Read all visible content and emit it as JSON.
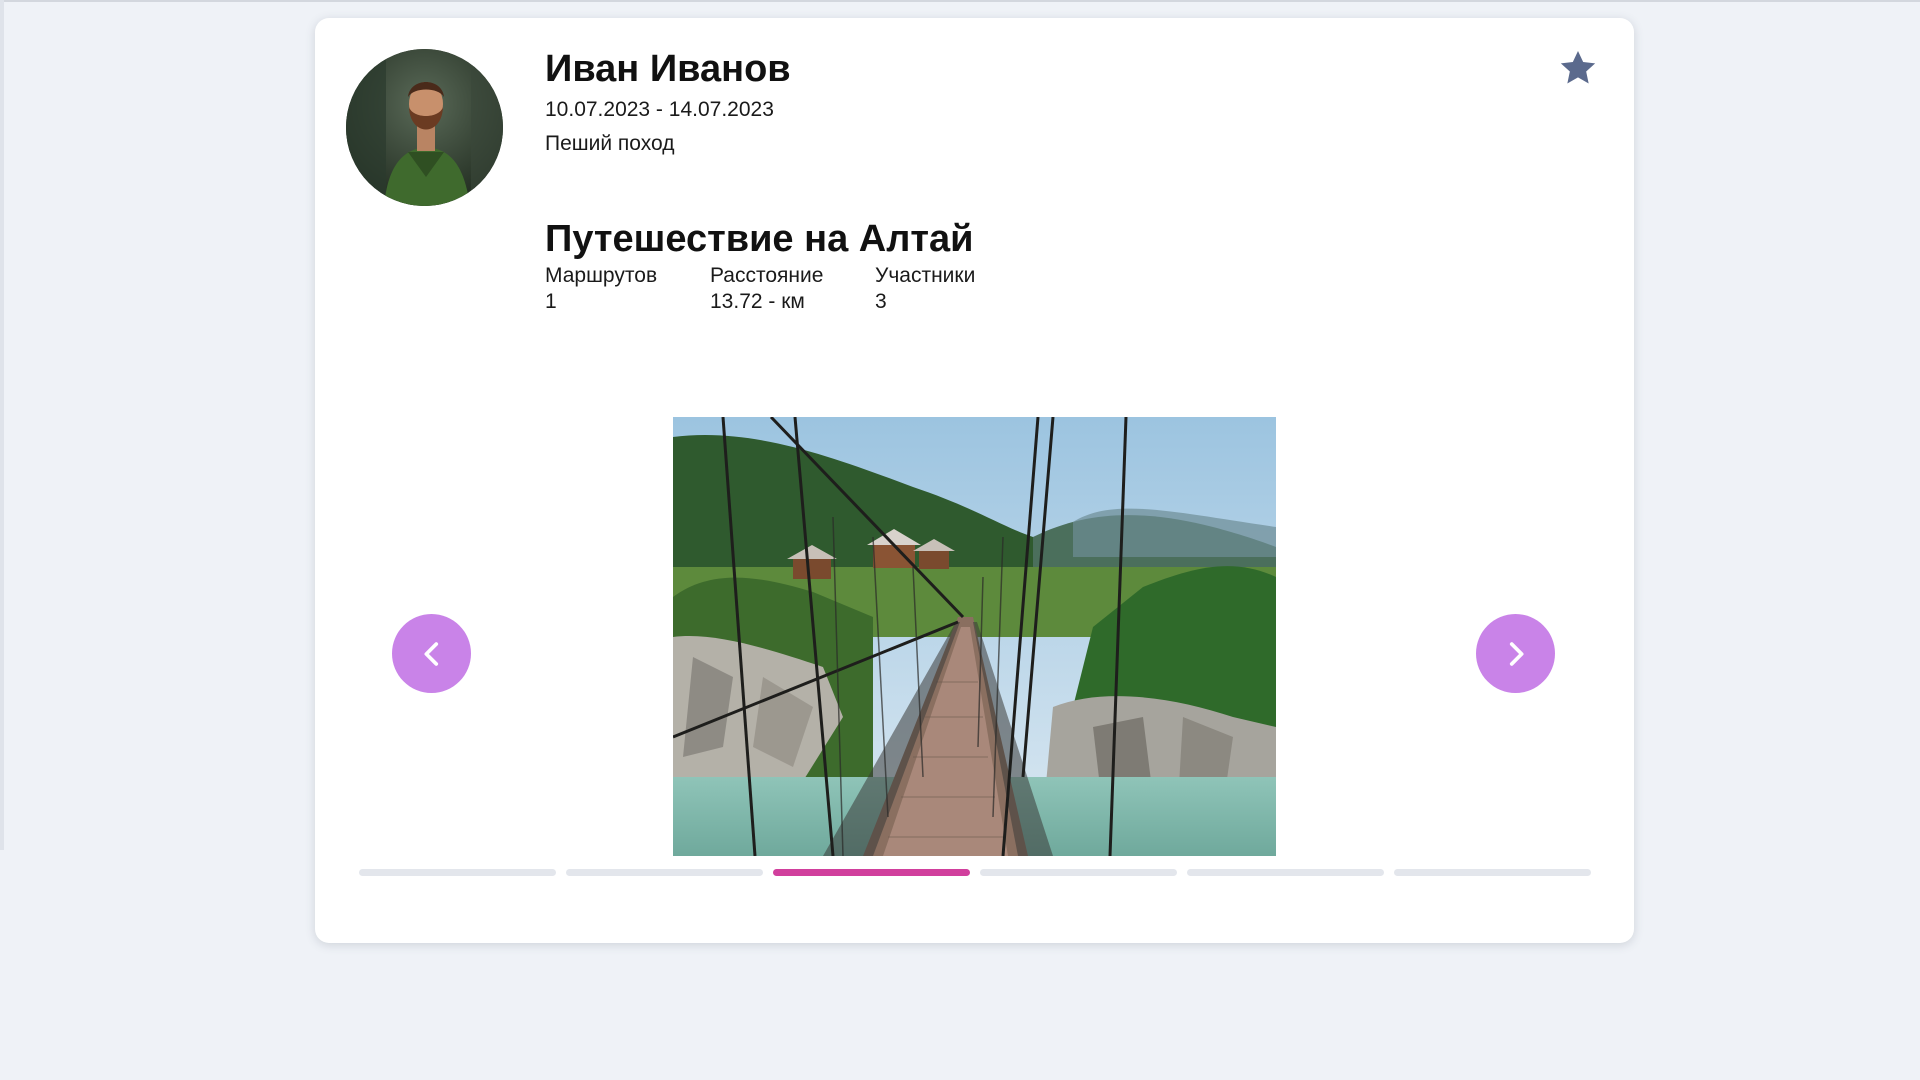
{
  "post": {
    "author_name": "Иван Иванов",
    "dates": "10.07.2023 - 14.07.2023",
    "trip_type": "Пеший поход",
    "title": "Путешествие на Алтай",
    "favorite_icon": "star-icon"
  },
  "stats": [
    {
      "label": "Маршрутов",
      "value": "1"
    },
    {
      "label": "Расстояние",
      "value": "13.72 - км"
    },
    {
      "label": "Участники",
      "value": "3"
    }
  ],
  "carousel": {
    "prev_icon": "chevron-left-icon",
    "next_icon": "chevron-right-icon",
    "slide_count": 6,
    "active_index": 2
  },
  "colors": {
    "page_background": "#eff2f7",
    "nav_button": "#c983e8",
    "indicator_active": "#d13f9d",
    "indicator_inactive": "#e3e6ec",
    "star": "#5b6a8d"
  }
}
